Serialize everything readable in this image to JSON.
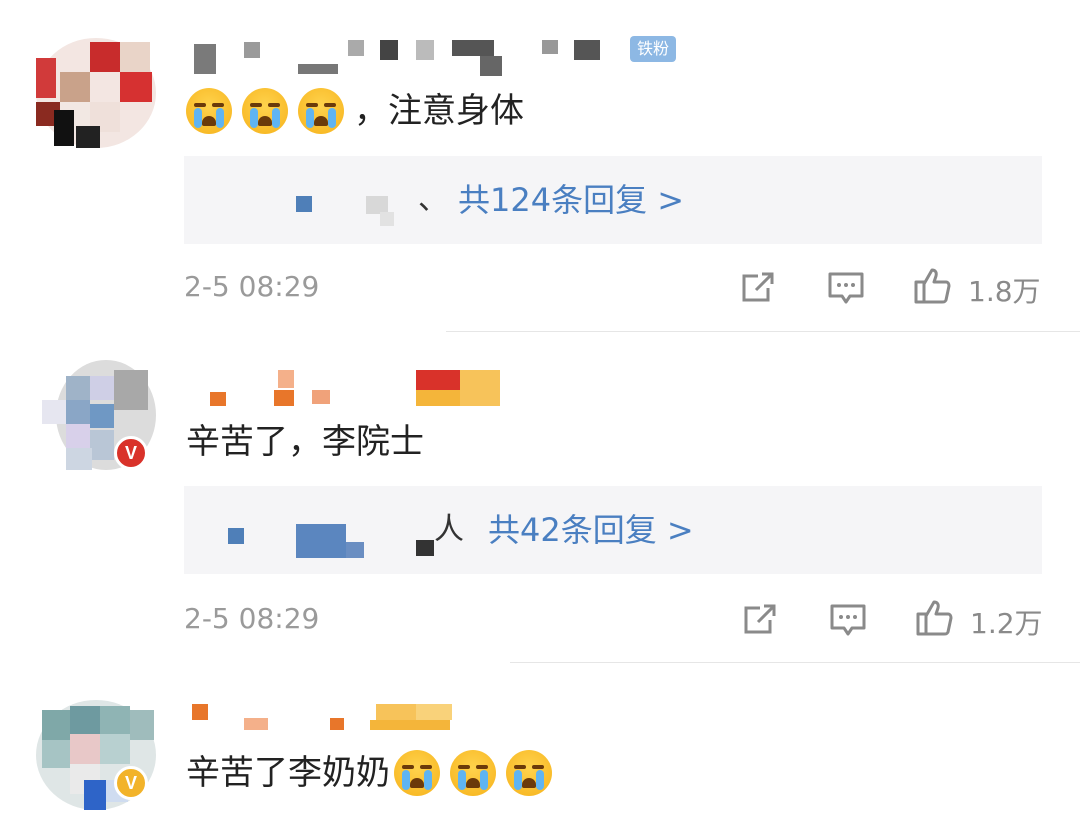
{
  "comments": [
    {
      "fan_badge": "铁粉",
      "text": "，注意身体",
      "emoji_count": 3,
      "reply_sep": "、",
      "reply_link": "共124条回复 >",
      "time": "2-5 08:29",
      "likes": "1.8万"
    },
    {
      "text": "辛苦了，李院士",
      "reply_sep": "人",
      "reply_link": "共42条回复 >",
      "time": "2-5 08:29",
      "likes": "1.2万",
      "badge": "V"
    },
    {
      "text": "辛苦了李奶奶",
      "emoji_count": 3,
      "badge": "V"
    }
  ],
  "icons": {
    "repost": "share-edit-icon",
    "comment": "comment-bubble-icon",
    "like": "thumbs-up-icon"
  },
  "colors": {
    "link": "#4a7fc1",
    "fan_badge": "#8db8e4",
    "gray_text": "#9a9a9a",
    "reply_bg": "#f5f5f7",
    "verified_red": "#d9322a",
    "verified_gold": "#f2b32a"
  }
}
